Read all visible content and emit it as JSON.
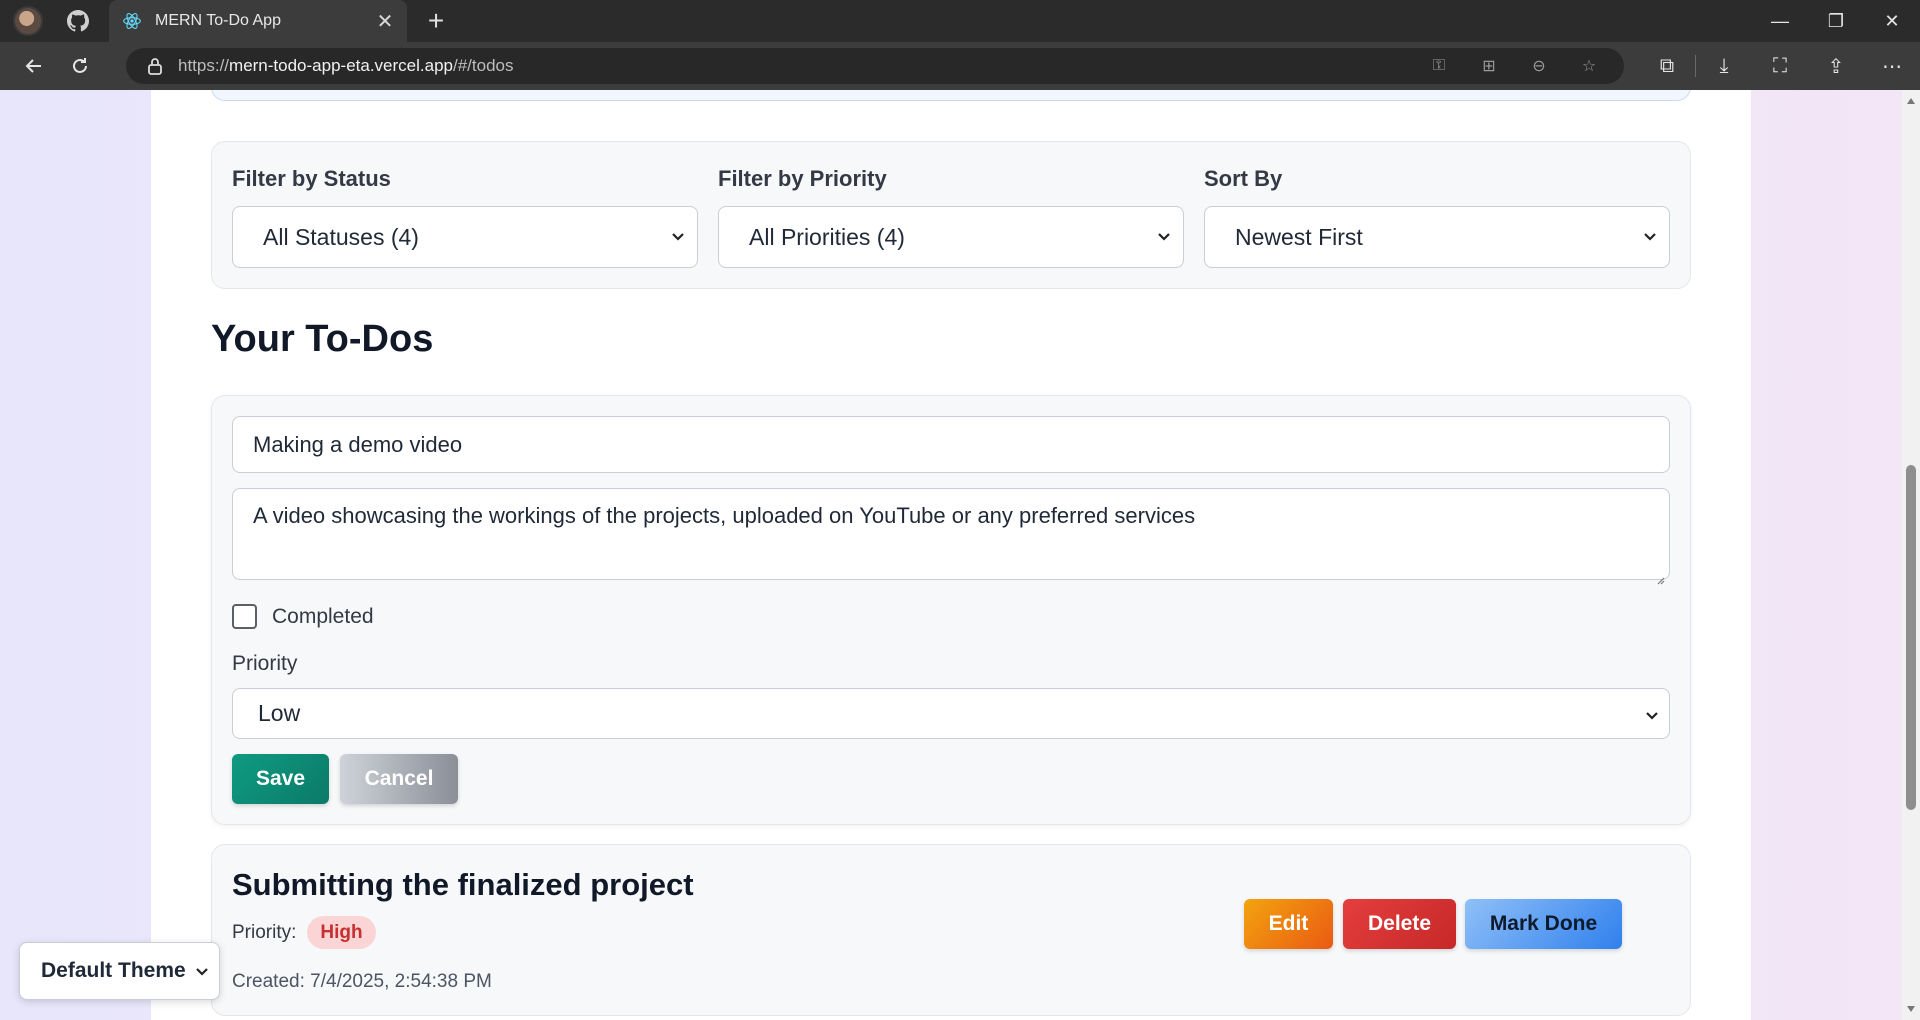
{
  "browser": {
    "tab_title": "MERN To-Do App",
    "url_prefix": "https://",
    "url_host": "mern-todo-app-eta.vercel.app",
    "url_path": "/#/todos"
  },
  "filters": {
    "status": {
      "label": "Filter by Status",
      "value": "All Statuses (4)"
    },
    "priority": {
      "label": "Filter by Priority",
      "value": "All Priorities (4)"
    },
    "sort": {
      "label": "Sort By",
      "value": "Newest First"
    }
  },
  "section_title": "Your To-Dos",
  "edit_form": {
    "title_value": "Making a demo video",
    "description_value": "A video showcasing the workings of the projects, uploaded on YouTube or any preferred services",
    "completed_label": "Completed",
    "completed_checked": false,
    "priority_label": "Priority",
    "priority_value": "Low",
    "save_label": "Save",
    "cancel_label": "Cancel"
  },
  "todo": {
    "title": "Submitting the finalized project",
    "priority_label": "Priority:",
    "priority_value": "High",
    "created": "Created: 7/4/2025, 2:54:38 PM",
    "edit_label": "Edit",
    "delete_label": "Delete",
    "done_label": "Mark Done"
  },
  "theme_select": {
    "value": "Default Theme"
  },
  "colors": {
    "save": "#0f9b81",
    "edit": "#f2a40f",
    "delete": "#e53e3e",
    "mark_done": "#2f80ed",
    "high_badge_bg": "#fbd5d5",
    "high_badge_text": "#c53030"
  }
}
